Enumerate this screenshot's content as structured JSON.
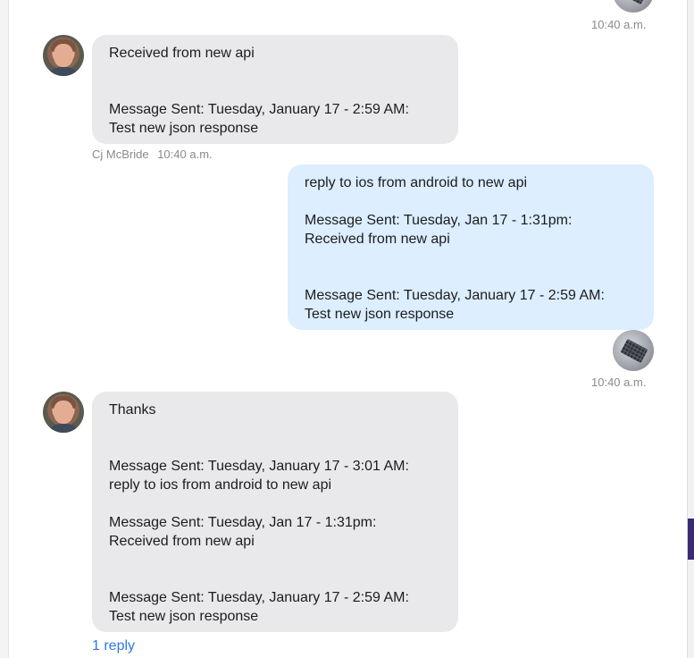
{
  "messages": [
    {
      "time": "10:40 a.m."
    },
    {
      "body": "Received from new api\n\n\nMessage Sent: Tuesday, January 17 - 2:59 AM:\nTest new json response",
      "sender": "Cj McBride",
      "time": "10:40 a.m."
    },
    {
      "body": "reply to ios from android to new api\n\nMessage Sent: Tuesday, Jan 17 - 1:31pm:\nReceived from new api\n\n\nMessage Sent: Tuesday, January 17 - 2:59 AM:\nTest new json response",
      "time": "10:40 a.m."
    },
    {
      "body": "Thanks\n\n\nMessage Sent: Tuesday, January 17 - 3:01 AM:\nreply to ios from android to new api\n\nMessage Sent: Tuesday, Jan 17 - 1:31pm:\nReceived from new api\n\n\nMessage Sent: Tuesday, January 17 - 2:59 AM:\nTest new json response",
      "reply_link": "1 reply"
    }
  ],
  "colors": {
    "incoming_bubble": "#e9e9ec",
    "outgoing_bubble": "#dceeff",
    "link": "#2a7ae2"
  }
}
